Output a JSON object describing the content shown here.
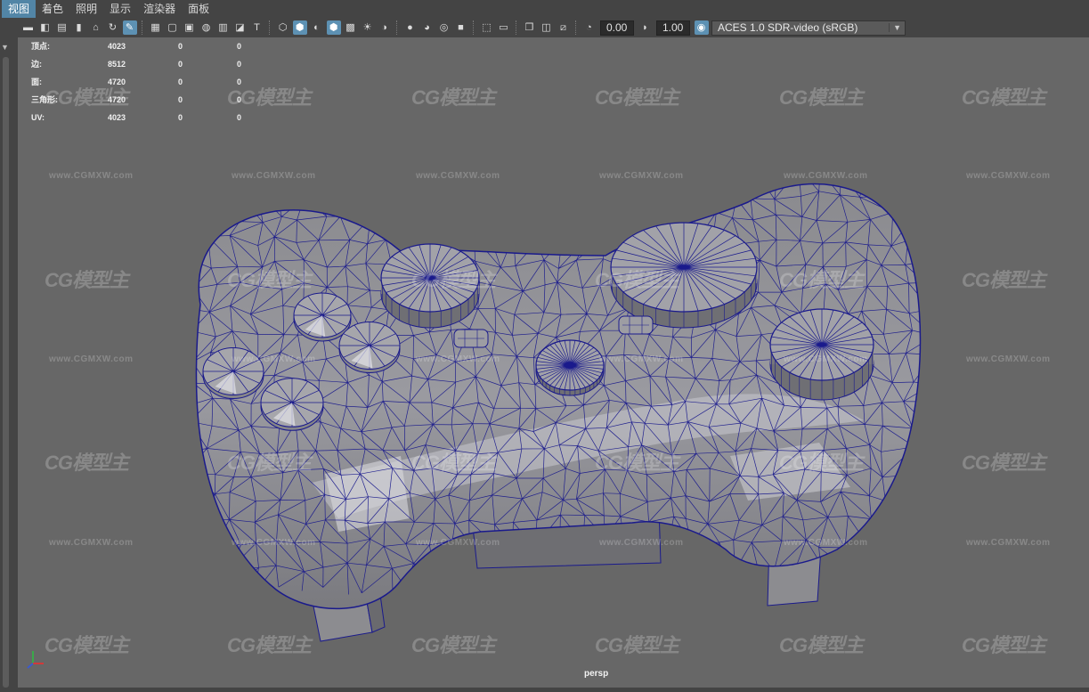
{
  "menu": {
    "items": [
      "视图",
      "着色",
      "照明",
      "显示",
      "渲染器",
      "面板"
    ],
    "active_index": 0
  },
  "toolbar": {
    "exposure_value": "0.00",
    "gamma_value": "1.00",
    "colorspace": "ACES 1.0 SDR-video (sRGB)",
    "accent_color": "#5d91b3"
  },
  "hud": {
    "rows": [
      {
        "label": "顶点:",
        "value": "4023",
        "c2": "0",
        "c3": "0"
      },
      {
        "label": "边:",
        "value": "8512",
        "c2": "0",
        "c3": "0"
      },
      {
        "label": "面:",
        "value": "4720",
        "c2": "0",
        "c3": "0"
      },
      {
        "label": "三角形:",
        "value": "4720",
        "c2": "0",
        "c3": "0"
      },
      {
        "label": "UV:",
        "value": "4023",
        "c2": "0",
        "c3": "0"
      }
    ]
  },
  "viewport": {
    "camera": "persp",
    "background_color": "#676767",
    "wireframe_color": "#1a1a8c"
  },
  "watermark": {
    "logo_text": "CG模型主",
    "url_text": "www.CGMXW.com"
  }
}
